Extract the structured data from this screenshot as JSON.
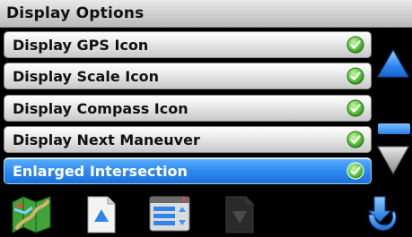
{
  "header": {
    "title": "Display Options"
  },
  "options": [
    {
      "label": "Display GPS Icon",
      "checked": true,
      "selected": false
    },
    {
      "label": "Display Scale Icon",
      "checked": true,
      "selected": false
    },
    {
      "label": "Display Compass Icon",
      "checked": true,
      "selected": false
    },
    {
      "label": "Display Next Maneuver",
      "checked": true,
      "selected": false
    },
    {
      "label": "Enlarged Intersection",
      "checked": true,
      "selected": true
    }
  ],
  "icons": {
    "check": "check-icon",
    "scroll_up": "scroll-up-arrow-icon",
    "scroll_down": "scroll-down-arrow-icon",
    "map": "map-icon",
    "page_up": "page-up-icon",
    "list": "list-settings-icon",
    "page_down": "page-down-icon",
    "back": "back-icon"
  },
  "colors": {
    "selected": "#2f8af2",
    "accent": "#3a9bff"
  }
}
